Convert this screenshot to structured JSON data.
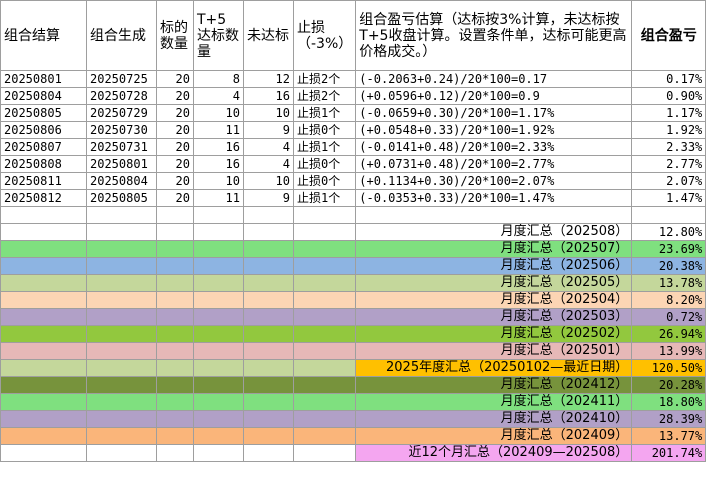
{
  "headers": {
    "settle": "组合结算",
    "create": "组合生成",
    "target_count": "标的数量",
    "t5_count": "T+5达标数量",
    "not_reached": "未达标",
    "stop_loss": "止损（-3%）",
    "estimate": "组合盈亏估算（达标按3%计算，未达标按T+5收盘计算。设置条件单，达标可能更高价格成交。）",
    "pnl": "组合盈亏"
  },
  "rows": [
    {
      "settle": "20250801",
      "create": "20250725",
      "count": "20",
      "t5": "8",
      "miss": "12",
      "stop": "止损2个",
      "est": "(-0.2063+0.24)/20*100=0.17",
      "pnl": "0.17%"
    },
    {
      "settle": "20250804",
      "create": "20250728",
      "count": "20",
      "t5": "4",
      "miss": "16",
      "stop": "止损2个",
      "est": "(+0.0596+0.12)/20*100=0.9",
      "pnl": "0.90%"
    },
    {
      "settle": "20250805",
      "create": "20250729",
      "count": "20",
      "t5": "10",
      "miss": "10",
      "stop": "止损1个",
      "est": "(-0.0659+0.30)/20*100=1.17%",
      "pnl": "1.17%"
    },
    {
      "settle": "20250806",
      "create": "20250730",
      "count": "20",
      "t5": "11",
      "miss": "9",
      "stop": "止损0个",
      "est": "(+0.0548+0.33)/20*100=1.92%",
      "pnl": "1.92%"
    },
    {
      "settle": "20250807",
      "create": "20250731",
      "count": "20",
      "t5": "16",
      "miss": "4",
      "stop": "止损1个",
      "est": "(-0.0141+0.48)/20*100=2.33%",
      "pnl": "2.33%"
    },
    {
      "settle": "20250808",
      "create": "20250801",
      "count": "20",
      "t5": "16",
      "miss": "4",
      "stop": "止损0个",
      "est": "(+0.0731+0.48)/20*100=2.77%",
      "pnl": "2.77%"
    },
    {
      "settle": "20250811",
      "create": "20250804",
      "count": "20",
      "t5": "10",
      "miss": "10",
      "stop": "止损0个",
      "est": "(+0.1134+0.30)/20*100=2.07%",
      "pnl": "2.07%"
    },
    {
      "settle": "20250812",
      "create": "20250805",
      "count": "20",
      "t5": "11",
      "miss": "9",
      "stop": "止损1个",
      "est": "(-0.0353+0.33)/20*100=1.47%",
      "pnl": "1.47%"
    }
  ],
  "summaries": [
    {
      "label": "月度汇总（202508）",
      "pct": "12.80%",
      "color": "#ffffff",
      "label_color": "#ffffff",
      "pct_color": "#ffffff"
    },
    {
      "label": "月度汇总（202507）",
      "pct": "23.69%",
      "color": "#7fe07f",
      "label_color": "#7fe07f",
      "pct_color": "#7fe07f"
    },
    {
      "label": "月度汇总（202506）",
      "pct": "20.38%",
      "color": "#8db4e2",
      "label_color": "#8db4e2",
      "pct_color": "#8db4e2"
    },
    {
      "label": "月度汇总（202505）",
      "pct": "13.78%",
      "color": "#c4d79b",
      "label_color": "#c4d79b",
      "pct_color": "#c4d79b"
    },
    {
      "label": "月度汇总（202504）",
      "pct": "8.20%",
      "color": "#fcd5b4",
      "label_color": "#fcd5b4",
      "pct_color": "#fcd5b4"
    },
    {
      "label": "月度汇总（202503）",
      "pct": "0.72%",
      "color": "#b1a0c7",
      "label_color": "#b1a0c7",
      "pct_color": "#b1a0c7"
    },
    {
      "label": "月度汇总（202502）",
      "pct": "26.94%",
      "color": "#92c83e",
      "label_color": "#92c83e",
      "pct_color": "#92c83e"
    },
    {
      "label": "月度汇总（202501）",
      "pct": "13.99%",
      "color": "#e6b8b7",
      "label_color": "#e6b8b7",
      "pct_color": "#e6b8b7"
    },
    {
      "label": "2025年度汇总（20250102—最近日期）",
      "pct": "120.50%",
      "color": "#c4d79b",
      "label_color": "#ffc000",
      "pct_color": "#ffc000"
    },
    {
      "label": "月度汇总（202412）",
      "pct": "20.28%",
      "color": "#77933c",
      "label_color": "#77933c",
      "pct_color": "#77933c"
    },
    {
      "label": "月度汇总（202411）",
      "pct": "18.80%",
      "color": "#7fe07f",
      "label_color": "#7fe07f",
      "pct_color": "#7fe07f"
    },
    {
      "label": "月度汇总（202410）",
      "pct": "28.39%",
      "color": "#b1a0c7",
      "label_color": "#b1a0c7",
      "pct_color": "#b1a0c7"
    },
    {
      "label": "月度汇总（202409）",
      "pct": "13.77%",
      "color": "#fab57a",
      "label_color": "#fab57a",
      "pct_color": "#fab57a"
    },
    {
      "label": "近12个月汇总（202409—202508）",
      "pct": "201.74%",
      "color": "#ffffff",
      "label_color": "#f4a6f0",
      "pct_color": "#f4a6f0"
    }
  ]
}
